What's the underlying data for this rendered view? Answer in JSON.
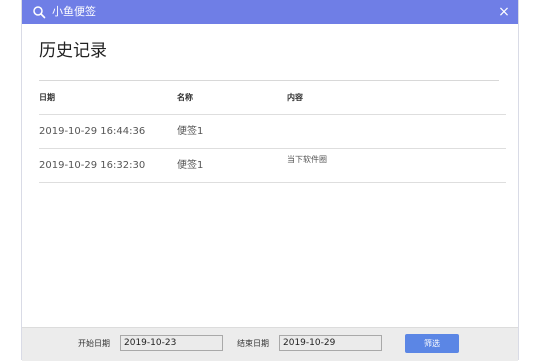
{
  "window": {
    "title": "小鱼便签",
    "close_label": "×"
  },
  "page_title": "历史记录",
  "table": {
    "headers": {
      "date": "日期",
      "name": "名称",
      "content": "内容"
    },
    "rows": [
      {
        "date": "2019-10-29 16:44:36",
        "name": "便签1",
        "content": ""
      },
      {
        "date": "2019-10-29 16:32:30",
        "name": "便签1",
        "content": "当下软件圈"
      }
    ]
  },
  "footer": {
    "start_label": "开始日期",
    "start_value": "2019-10-23",
    "end_label": "结束日期",
    "end_value": "2019-10-29",
    "filter_label": "筛选"
  },
  "colors": {
    "titlebar": "#6f7ee6",
    "filter_button": "#5b86e5"
  },
  "icons": {
    "title_icon": "search-icon",
    "close_icon": "close-icon"
  }
}
